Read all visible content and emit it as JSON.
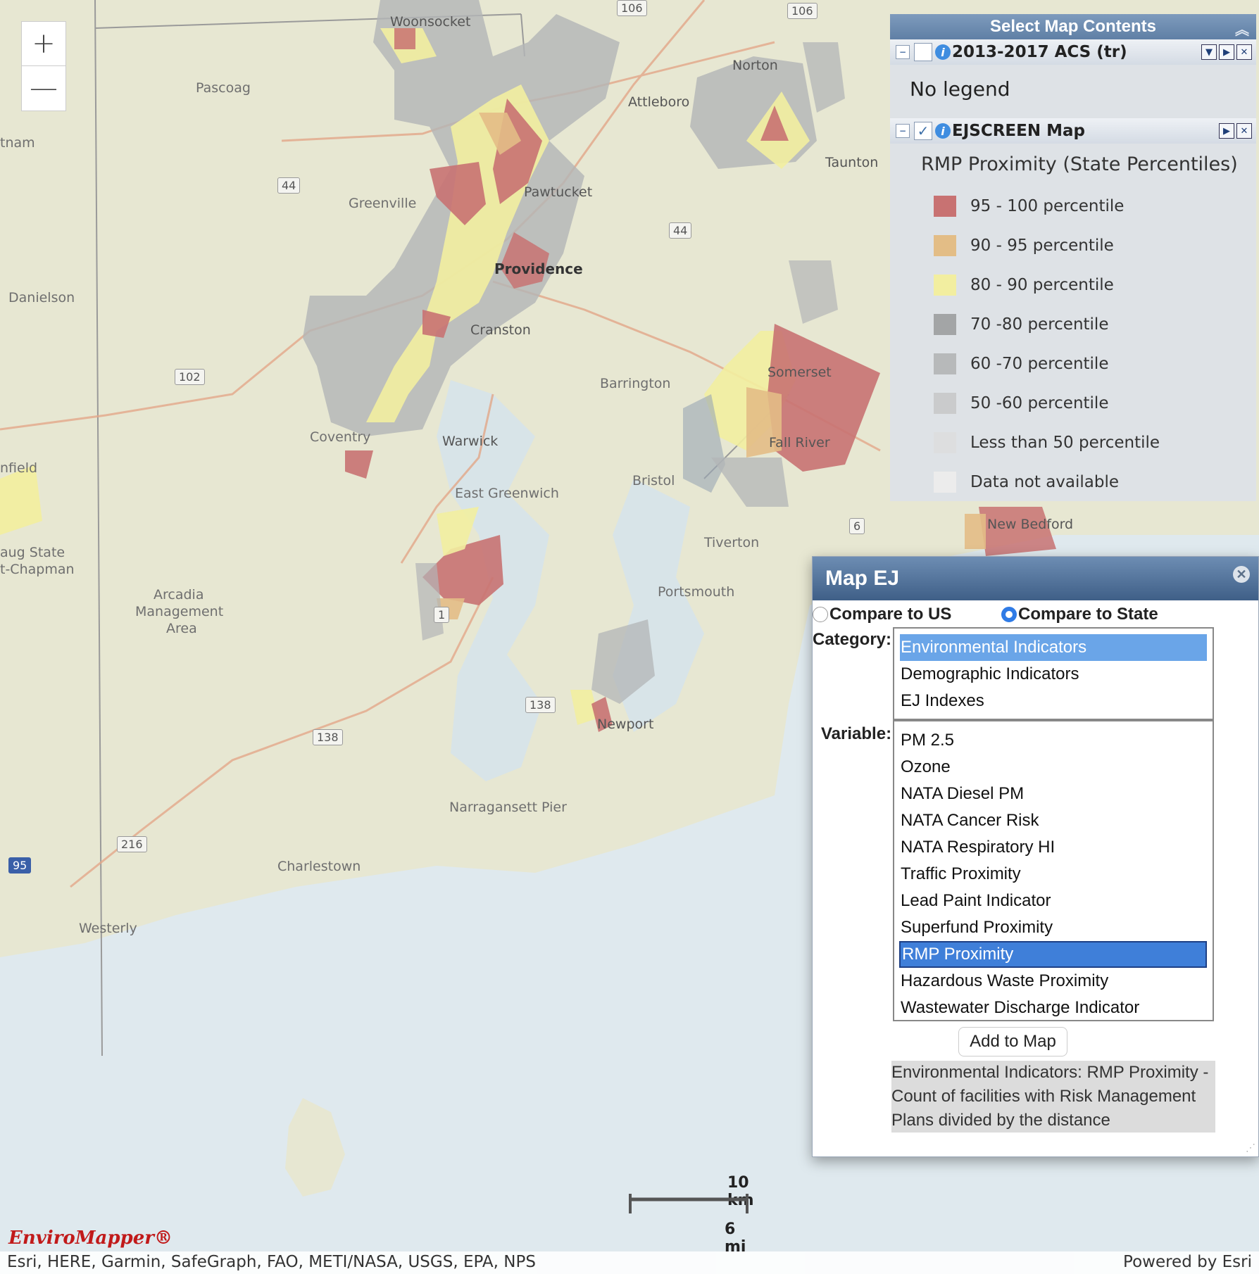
{
  "map": {
    "places": [
      {
        "name": "Woonsocket",
        "cls": "city"
      },
      {
        "name": "Pascoag",
        "cls": ""
      },
      {
        "name": "Norton",
        "cls": "city"
      },
      {
        "name": "Attleboro",
        "cls": "city"
      },
      {
        "name": "Taunton",
        "cls": "city"
      },
      {
        "name": "Greenville",
        "cls": ""
      },
      {
        "name": "Pawtucket",
        "cls": "city"
      },
      {
        "name": "Providence",
        "cls": "bold"
      },
      {
        "name": "Cranston",
        "cls": "city"
      },
      {
        "name": "Danielson",
        "cls": ""
      },
      {
        "name": "Barrington",
        "cls": ""
      },
      {
        "name": "Somerset",
        "cls": "city"
      },
      {
        "name": "Fall River",
        "cls": "city"
      },
      {
        "name": "Coventry",
        "cls": ""
      },
      {
        "name": "Warwick",
        "cls": "city"
      },
      {
        "name": "Bristol",
        "cls": ""
      },
      {
        "name": "East Greenwich",
        "cls": ""
      },
      {
        "name": "New Bedford",
        "cls": "city"
      },
      {
        "name": "Tiverton",
        "cls": ""
      },
      {
        "name": "Portsmouth",
        "cls": ""
      },
      {
        "name": "Newport",
        "cls": "city"
      },
      {
        "name": "Narragansett Pier",
        "cls": ""
      },
      {
        "name": "Charlestown",
        "cls": ""
      },
      {
        "name": "Westerly",
        "cls": ""
      },
      {
        "name": "tnam",
        "cls": ""
      },
      {
        "name": "nfield",
        "cls": ""
      },
      {
        "name": "aug State",
        "cls": ""
      },
      {
        "name": "t-Chapman",
        "cls": ""
      },
      {
        "name": "Arcadia",
        "cls": ""
      },
      {
        "name": "Management",
        "cls": ""
      },
      {
        "name": "Area",
        "cls": ""
      }
    ],
    "shields": [
      "106",
      "106",
      "44",
      "44",
      "102",
      "6",
      "1",
      "138",
      "138",
      "216",
      "95"
    ]
  },
  "zoom": {
    "in": "+",
    "out": "—"
  },
  "legend_panel": {
    "title": "Select Map Contents",
    "collapse_icon": "double-chevron-up-icon",
    "layer1": {
      "name": "2013-2017 ACS (tr)",
      "note": "No legend"
    },
    "layer2": {
      "name": "EJSCREEN Map",
      "subtitle": "RMP Proximity (State Percentiles)"
    },
    "items": [
      {
        "label": "95 - 100 percentile",
        "color": "#c87272"
      },
      {
        "label": "90 - 95 percentile",
        "color": "#e3bd86"
      },
      {
        "label": "80 - 90 percentile",
        "color": "#f2eea0"
      },
      {
        "label": "70 -80 percentile",
        "color": "#a3a5a6"
      },
      {
        "label": "60 -70 percentile",
        "color": "#b7b9ba"
      },
      {
        "label": "50 -60 percentile",
        "color": "#cacbcc"
      },
      {
        "label": "Less than 50 percentile",
        "color": "#dddedf"
      },
      {
        "label": "Data not available",
        "color": "#ececec"
      }
    ]
  },
  "dialog": {
    "title": "Map EJ",
    "radio_us": "Compare to US",
    "radio_state": "Compare to State",
    "category_label": "Category:",
    "variable_label": "Variable:",
    "categories": [
      "Environmental Indicators",
      "Demographic Indicators",
      "EJ Indexes"
    ],
    "variables": [
      "PM 2.5",
      "Ozone",
      "NATA Diesel PM",
      "NATA Cancer Risk",
      "NATA Respiratory HI",
      "Traffic Proximity",
      "Lead Paint Indicator",
      "Superfund Proximity",
      "RMP Proximity",
      "Hazardous Waste Proximity",
      "Wastewater Discharge Indicator"
    ],
    "add_button": "Add to Map",
    "description": "Environmental Indicators: RMP Proximity - Count of facilities with Risk Management Plans divided by the distance"
  },
  "scale": {
    "km": "10 km",
    "mi": "6 mi"
  },
  "attribution": {
    "left": "Esri, HERE, Garmin, SafeGraph, FAO, METI/NASA, USGS, EPA, NPS",
    "right": "Powered by Esri"
  },
  "logo": "EnviroMapper®"
}
